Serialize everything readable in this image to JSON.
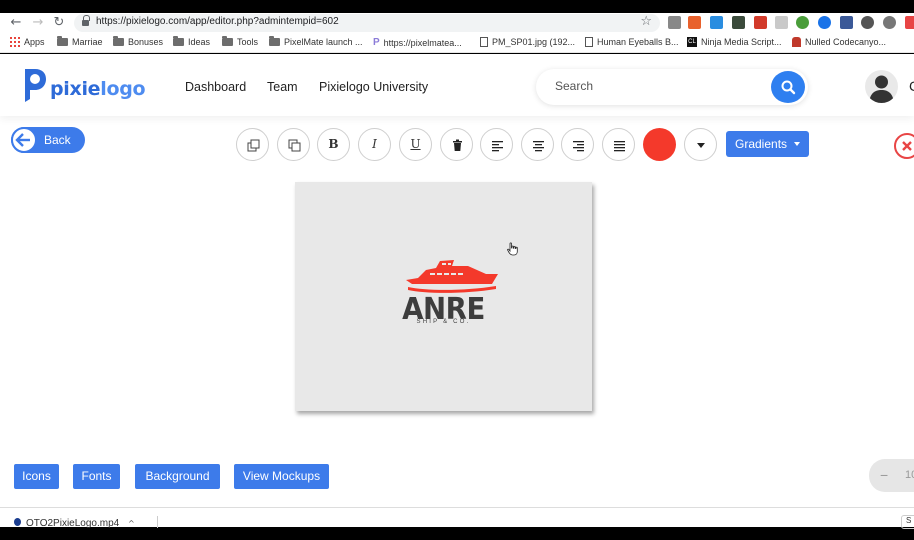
{
  "browser": {
    "url": "https://pixielogo.com/app/editor.php?admintempid=602",
    "bookmarks": [
      {
        "label": "Apps"
      },
      {
        "label": "Marriae"
      },
      {
        "label": "Bonuses"
      },
      {
        "label": "Ideas"
      },
      {
        "label": "Tools"
      },
      {
        "label": "PixelMate launch ..."
      },
      {
        "label": "https://pixelmatea..."
      },
      {
        "label": "PM_SP01.jpg (192..."
      },
      {
        "label": "Human Eyeballs B..."
      },
      {
        "label": "Ninja Media Script..."
      },
      {
        "label": "Nulled Codecanyo..."
      }
    ]
  },
  "header": {
    "logo_text_a": "pixie",
    "logo_text_b": "logo",
    "nav": [
      "Dashboard",
      "Team",
      "Pixielogo University"
    ],
    "search_placeholder": "Search",
    "user_initial": "C"
  },
  "toolbar": {
    "back_label": "Back",
    "bold": "B",
    "italic": "I",
    "underline": "U",
    "gradients_label": "Gradients",
    "selected_color": "#f4392b"
  },
  "canvas": {
    "logo_name": "ANRE",
    "logo_tagline": "SHIP & CO.",
    "logo_color": "#f4392b",
    "text_color": "#3d3d3d"
  },
  "bottom": {
    "buttons": [
      "Icons",
      "Fonts",
      "Background",
      "View Mockups"
    ],
    "zoom_minus": "−",
    "zoom_value": "10"
  },
  "downloads": {
    "file": "OTO2PixieLogo.mp4",
    "show_all": "S"
  }
}
